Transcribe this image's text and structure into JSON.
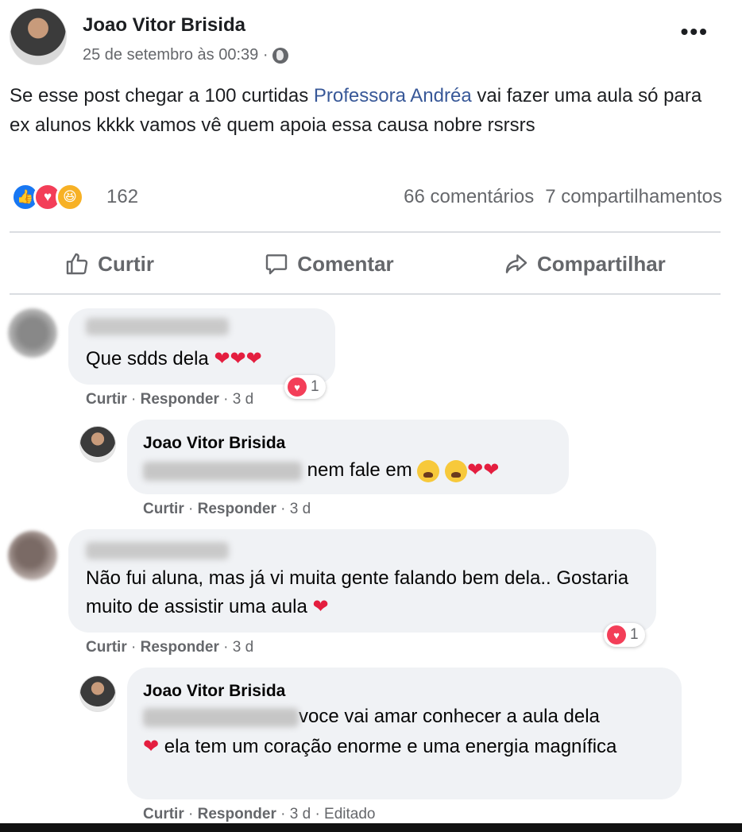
{
  "post": {
    "author": "Joao Vitor Brisida",
    "date": "25 de setembro às 00:39 ·",
    "more": "•••",
    "text_before": "Se esse post chegar a 100 curtidas ",
    "mention": "Professora Andréa",
    "text_after": " vai fazer uma aula só para ex alunos kkkk vamos vê quem apoia essa causa nobre rsrsrs"
  },
  "stats": {
    "reaction_count": "162",
    "comments": "66 comentários",
    "shares": "7 compartilhamentos",
    "reaction_icons": [
      "like-icon",
      "love-icon",
      "haha-icon"
    ]
  },
  "actions": {
    "like": "Curtir",
    "comment": "Comentar",
    "share": "Compartilhar"
  },
  "comments": [
    {
      "text": "Que sdds dela ❤❤❤",
      "like": "Curtir",
      "reply": "Responder",
      "time": "· 3 d",
      "reactions": "1"
    },
    {
      "author": "Joao Vitor Brisida",
      "text": " nem fale em ",
      "hearts": "❤❤",
      "like": "Curtir",
      "reply": "Responder",
      "time": "· 3 d"
    },
    {
      "text": "Não fui aluna, mas já vi muita gente falando bem dela.. Gostaria muito de assistir uma aula ❤",
      "like": "Curtir",
      "reply": "Responder",
      "time": "· 3 d",
      "reactions": "1"
    },
    {
      "author": "Joao Vitor Brisida",
      "text_line1": "voce vai amar conhecer a aula dela",
      "text_line2": "❤ ela tem um coração enorme e uma energia magnífica",
      "like": "Curtir",
      "reply": "Responder",
      "time": "· 3 d · Editado"
    }
  ],
  "colors": {
    "mention": "#385898",
    "like": "#1877f2",
    "love": "#f33e58",
    "haha": "#f7b125",
    "bubble": "#f0f2f5"
  }
}
